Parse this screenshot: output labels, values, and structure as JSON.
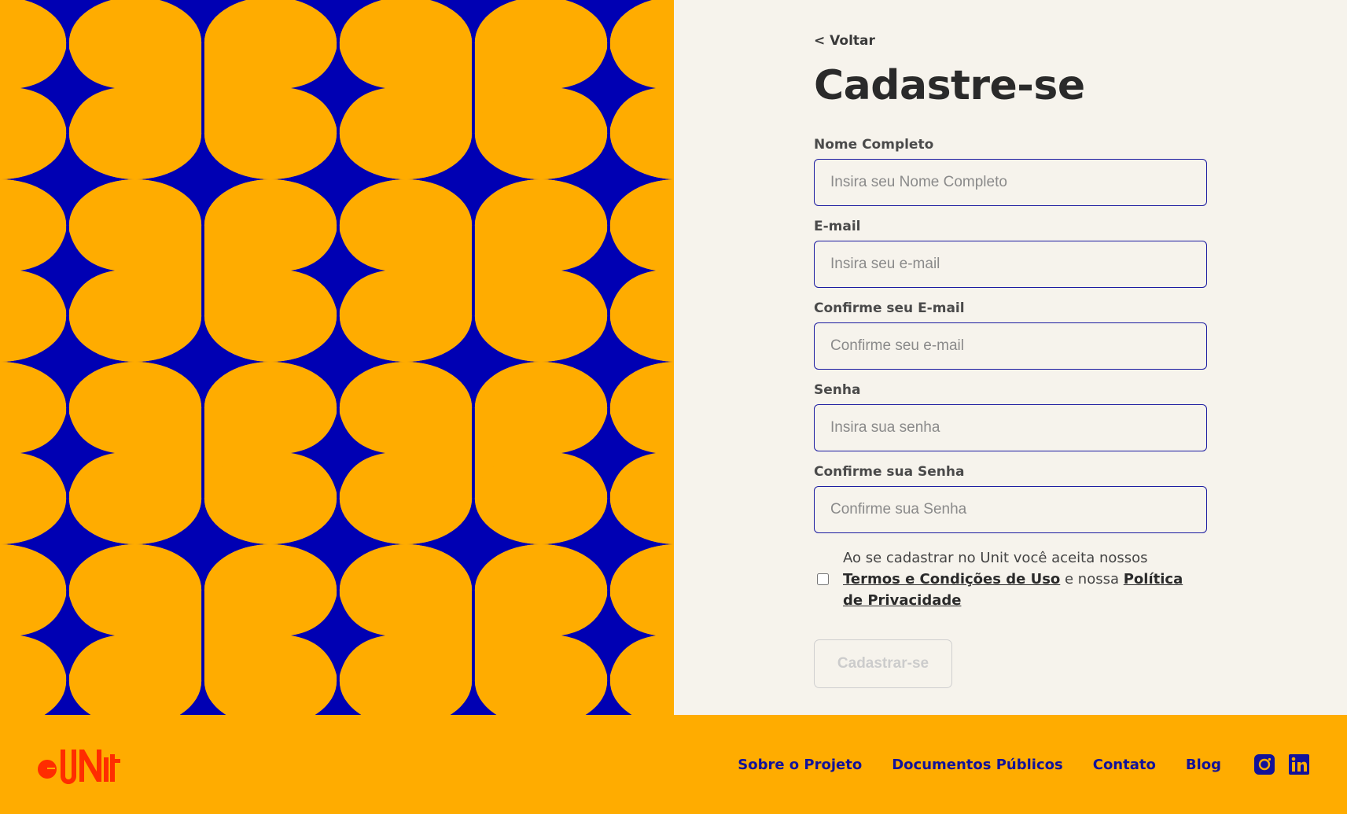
{
  "colors": {
    "art_background": "#0000b3",
    "art_shape": "#ffac00",
    "panel_background": "#f6f3ec",
    "footer_background": "#ffac00",
    "footer_link": "#12129a",
    "logo": "#ff2d00"
  },
  "back_link": "< Voltar",
  "page_title": "Cadastre-se",
  "fields": [
    {
      "label": "Nome Completo",
      "placeholder": "Insira seu Nome Completo",
      "type": "text"
    },
    {
      "label": "E-mail",
      "placeholder": "Insira seu e-mail",
      "type": "email"
    },
    {
      "label": "Confirme seu E-mail",
      "placeholder": "Confirme seu e-mail",
      "type": "email"
    },
    {
      "label": "Senha",
      "placeholder": "Insira sua senha",
      "type": "password"
    },
    {
      "label": "Confirme sua Senha",
      "placeholder": "Confirme sua Senha",
      "type": "password"
    }
  ],
  "terms": {
    "checked": false,
    "text_before": "Ao se cadastrar no Unit você aceita nossos ",
    "terms_link": "Termos e Condições de Uso",
    "text_middle": " e nossa ",
    "privacy_link": "Política de Privacidade"
  },
  "submit_label": "Cadastrar-se",
  "footer": {
    "logo_text": "Unit",
    "nav": [
      "Sobre o Projeto",
      "Documentos Públicos",
      "Contato",
      "Blog"
    ],
    "social_icons": [
      "instagram-icon",
      "linkedin-icon"
    ]
  }
}
